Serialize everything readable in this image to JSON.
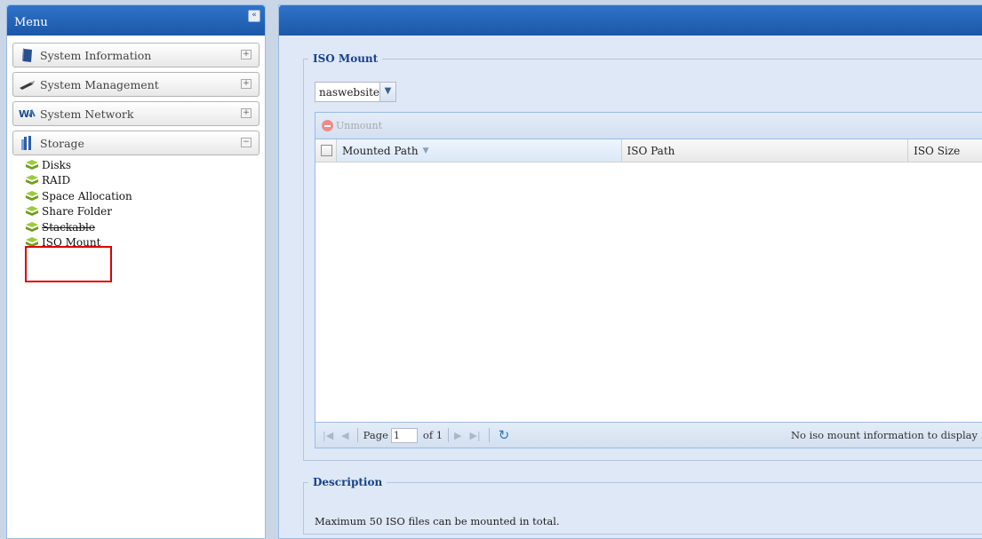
{
  "menu": {
    "title": "Menu",
    "collapse_glyph": "«",
    "groups": [
      {
        "label": "System Information",
        "icon": "book-icon",
        "toggle": "+"
      },
      {
        "label": "System Management",
        "icon": "wrench-icon",
        "toggle": "+"
      },
      {
        "label": "System Network",
        "icon": "network-icon",
        "toggle": "+"
      },
      {
        "label": "Storage",
        "icon": "storage-icon",
        "toggle": "−"
      }
    ],
    "storage_items": [
      "Disks",
      "RAID",
      "Space Allocation",
      "Share Folder",
      "Stackable",
      "ISO Mount"
    ]
  },
  "iso_mount": {
    "legend": "ISO Mount",
    "select_value": "naswebsite",
    "toolbar": {
      "unmount_label": "Unmount"
    },
    "columns": [
      "Mounted Path",
      "ISO Path",
      "ISO Size"
    ],
    "pager": {
      "page_label": "Page",
      "page_value": "1",
      "of_label": "of 1"
    },
    "empty_message": "No iso mount information to display"
  },
  "description": {
    "legend": "Description",
    "text": "Maximum 50 ISO files can be mounted in total."
  },
  "colors": {
    "header_blue": "#1c57a8",
    "highlight_red": "#e00000"
  }
}
